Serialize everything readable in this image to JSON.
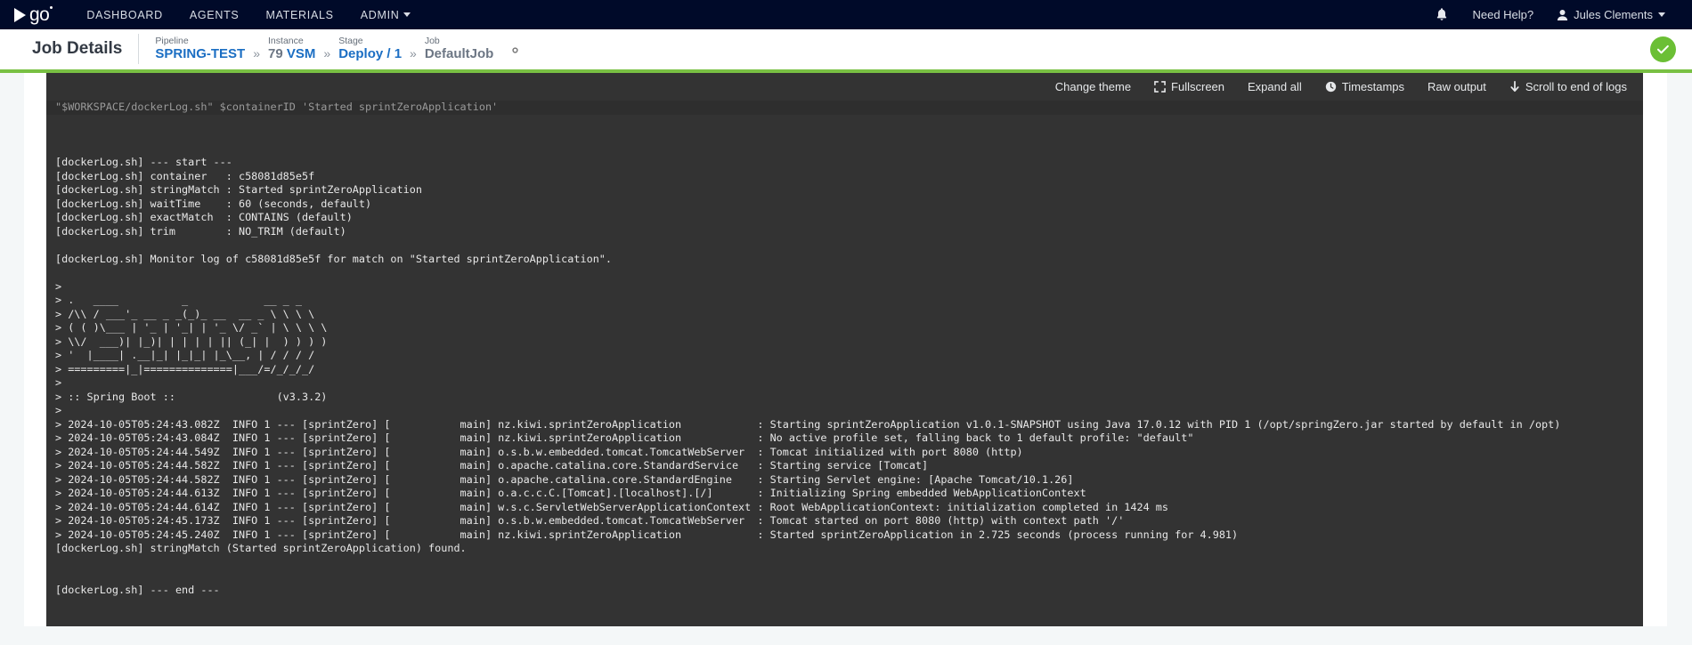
{
  "topnav": {
    "logo_text": "go",
    "items": [
      {
        "label": "DASHBOARD",
        "name": "dashboard",
        "caret": false
      },
      {
        "label": "AGENTS",
        "name": "agents",
        "caret": false
      },
      {
        "label": "MATERIALS",
        "name": "materials",
        "caret": false
      },
      {
        "label": "ADMIN",
        "name": "admin",
        "caret": true
      }
    ],
    "bell_icon": "bell-icon",
    "need_help": "Need Help?",
    "user_name": "Jules Clements",
    "user_icon": "user-icon",
    "background": "#000a29"
  },
  "subheader": {
    "page_title": "Job Details",
    "crumbs": [
      {
        "label": "Pipeline",
        "value": "SPRING-TEST",
        "link": true
      },
      {
        "label": "Instance",
        "value": "79 VSM",
        "link": true,
        "split": {
          "dim": "79",
          "link": "VSM"
        }
      },
      {
        "label": "Stage",
        "value": "Deploy / 1",
        "link": true
      },
      {
        "label": "Job",
        "value": "DefaultJob",
        "link": false
      }
    ],
    "separator": "»",
    "gear_icon": "gear-icon",
    "status_icon": "check-icon",
    "status_color": "#6bbf35",
    "accent_bar_color": "#79c043"
  },
  "log_toolbar": {
    "items": [
      {
        "label": "Change theme",
        "icon": null,
        "name": "change-theme"
      },
      {
        "label": "Fullscreen",
        "icon": "fullscreen-icon",
        "name": "fullscreen"
      },
      {
        "label": "Expand all",
        "icon": null,
        "name": "expand-all"
      },
      {
        "label": "Timestamps",
        "icon": "clock-icon",
        "name": "timestamps"
      },
      {
        "label": "Raw output",
        "icon": null,
        "name": "raw-output"
      },
      {
        "label": "Scroll to end of logs",
        "icon": "arrow-down-icon",
        "name": "scroll-to-end"
      }
    ]
  },
  "console": {
    "background": "#333333",
    "partial_top_line": "\"$WORKSPACE/dockerLog.sh\" $containerID 'Started sprintZeroApplication'",
    "lines": [
      "",
      "[dockerLog.sh] --- start ---",
      "[dockerLog.sh] container   : c58081d85e5f",
      "[dockerLog.sh] stringMatch : Started sprintZeroApplication",
      "[dockerLog.sh] waitTime    : 60 (seconds, default)",
      "[dockerLog.sh] exactMatch  : CONTAINS (default)",
      "[dockerLog.sh] trim        : NO_TRIM (default)",
      "",
      "[dockerLog.sh] Monitor log of c58081d85e5f for match on \"Started sprintZeroApplication\".",
      "",
      ">",
      "> .   ____          _            __ _ _",
      "> /\\\\ / ___'_ __ _ _(_)_ __  __ _ \\ \\ \\ \\",
      "> ( ( )\\___ | '_ | '_| | '_ \\/ _` | \\ \\ \\ \\",
      "> \\\\/  ___)| |_)| | | | | || (_| |  ) ) ) )",
      "> '  |____| .__|_| |_|_| |_\\__, | / / / /",
      "> =========|_|==============|___/=/_/_/_/",
      ">",
      "> :: Spring Boot ::                (v3.3.2)",
      ">",
      "> 2024-10-05T05:24:43.082Z  INFO 1 --- [sprintZero] [           main] nz.kiwi.sprintZeroApplication            : Starting sprintZeroApplication v1.0.1-SNAPSHOT using Java 17.0.12 with PID 1 (/opt/springZero.jar started by default in /opt)",
      "> 2024-10-05T05:24:43.084Z  INFO 1 --- [sprintZero] [           main] nz.kiwi.sprintZeroApplication            : No active profile set, falling back to 1 default profile: \"default\"",
      "> 2024-10-05T05:24:44.549Z  INFO 1 --- [sprintZero] [           main] o.s.b.w.embedded.tomcat.TomcatWebServer  : Tomcat initialized with port 8080 (http)",
      "> 2024-10-05T05:24:44.582Z  INFO 1 --- [sprintZero] [           main] o.apache.catalina.core.StandardService   : Starting service [Tomcat]",
      "> 2024-10-05T05:24:44.582Z  INFO 1 --- [sprintZero] [           main] o.apache.catalina.core.StandardEngine    : Starting Servlet engine: [Apache Tomcat/10.1.26]",
      "> 2024-10-05T05:24:44.613Z  INFO 1 --- [sprintZero] [           main] o.a.c.c.C.[Tomcat].[localhost].[/]       : Initializing Spring embedded WebApplicationContext",
      "> 2024-10-05T05:24:44.614Z  INFO 1 --- [sprintZero] [           main] w.s.c.ServletWebServerApplicationContext : Root WebApplicationContext: initialization completed in 1424 ms",
      "> 2024-10-05T05:24:45.173Z  INFO 1 --- [sprintZero] [           main] o.s.b.w.embedded.tomcat.TomcatWebServer  : Tomcat started on port 8080 (http) with context path '/'",
      "> 2024-10-05T05:24:45.240Z  INFO 1 --- [sprintZero] [           main] nz.kiwi.sprintZeroApplication            : Started sprintZeroApplication in 2.725 seconds (process running for 4.981)",
      "[dockerLog.sh] stringMatch (Started sprintZeroApplication) found.",
      "",
      "",
      "[dockerLog.sh] --- end ---"
    ]
  }
}
